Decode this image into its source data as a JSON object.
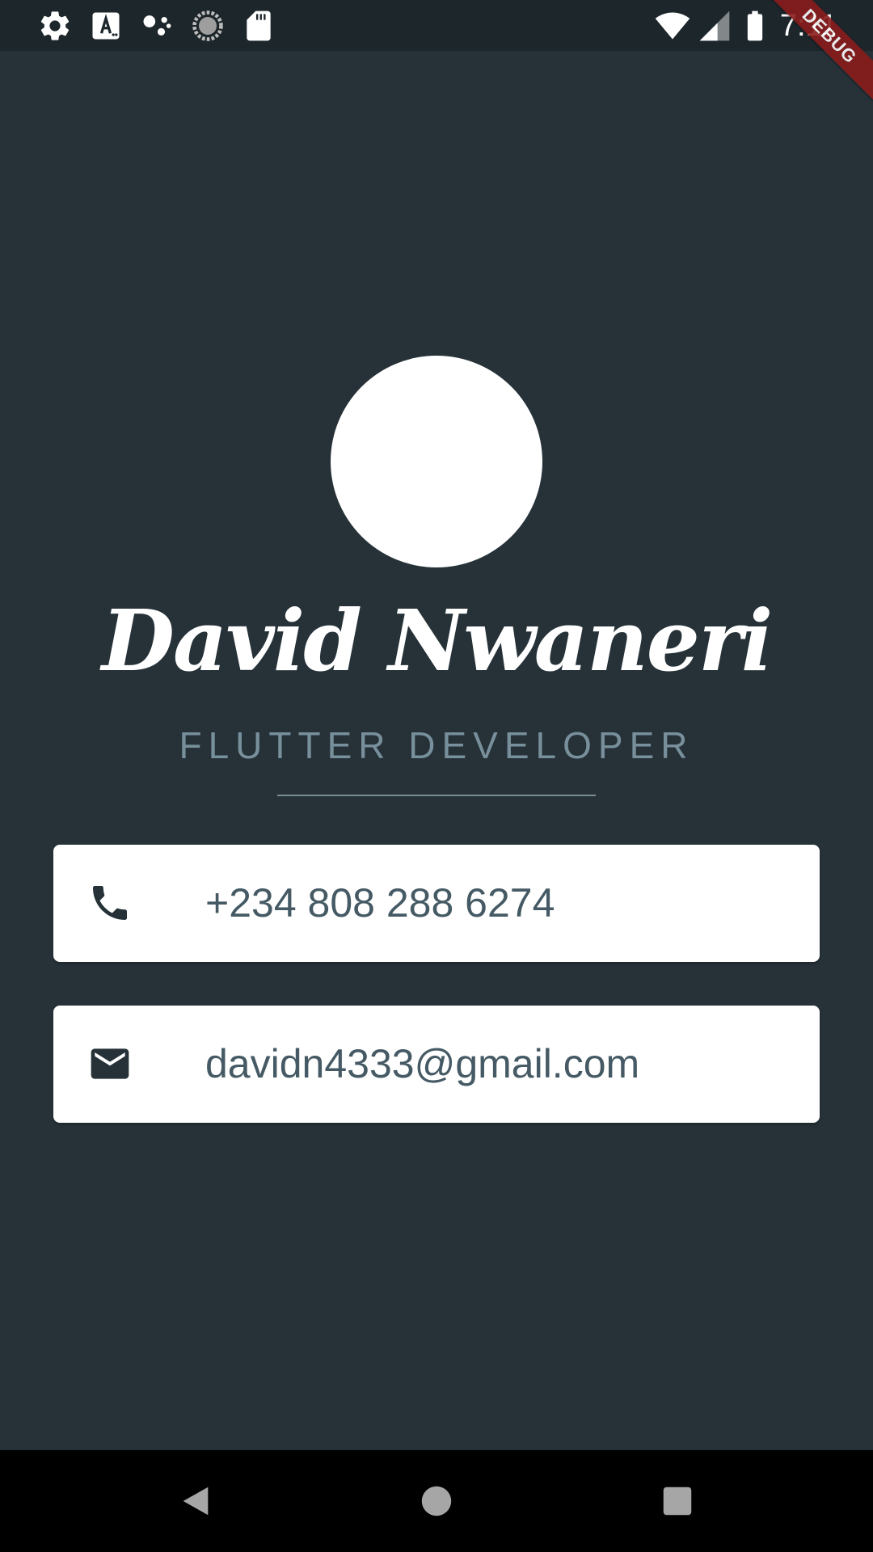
{
  "status_bar": {
    "time": "7:11",
    "left_icons": [
      "gear-icon",
      "font-a-icon",
      "assistant-dots-icon",
      "sync-circle-icon",
      "sd-card-icon"
    ],
    "right_icons": [
      "wifi-icon",
      "signal-icon",
      "battery-icon"
    ]
  },
  "debug_banner": {
    "label": "DEBUG",
    "color": "#8a1c1c"
  },
  "profile": {
    "name": "David Nwaneri",
    "title": "FLUTTER DEVELOPER"
  },
  "contacts": {
    "phone": {
      "icon": "phone-icon",
      "value": "+234 808 288 6274"
    },
    "email": {
      "icon": "mail-icon",
      "value": "davidn4333@gmail.com"
    }
  },
  "colors": {
    "background": "#263238",
    "card": "#ffffff",
    "card_text": "#455a64",
    "subtitle": "#78909c"
  },
  "nav_bar": {
    "buttons": [
      "back-icon",
      "home-icon",
      "recents-icon"
    ]
  }
}
